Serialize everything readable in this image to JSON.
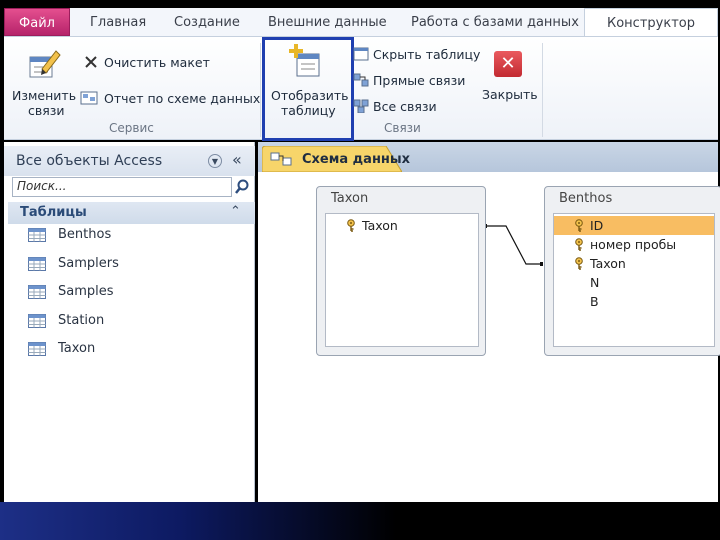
{
  "tabs": {
    "file": "Файл",
    "home": "Главная",
    "create": "Создание",
    "external": "Внешние данные",
    "dbtools": "Работа с базами данных",
    "design": "Конструктор"
  },
  "ribbon": {
    "edit_relations_1": "Изменить",
    "edit_relations_2": "связи",
    "clear_layout": "Очистить макет",
    "relationship_report": "Отчет по схеме данных",
    "group_tools": "Сервис",
    "show_table_1": "Отобразить",
    "show_table_2": "таблицу",
    "hide_table": "Скрыть таблицу",
    "direct_relationships": "Прямые связи",
    "all_relationships": "Все связи",
    "close": "Закрыть",
    "group_relationships": "Связи"
  },
  "nav": {
    "title": "Все объекты Access",
    "search_placeholder": "Поиск...",
    "section": "Таблицы",
    "items": [
      "Benthos",
      "Samplers",
      "Samples",
      "Station",
      "Taxon"
    ]
  },
  "document": {
    "tab_label": "Схема данных",
    "tables": [
      {
        "title": "Taxon",
        "fields": [
          {
            "name": "Taxon",
            "key": true
          }
        ]
      },
      {
        "title": "Benthos",
        "fields": [
          {
            "name": "ID",
            "key": true,
            "selected": true
          },
          {
            "name": "номер пробы",
            "key": true
          },
          {
            "name": "Taxon",
            "key": true
          },
          {
            "name": "N",
            "key": false
          },
          {
            "name": "B",
            "key": false
          }
        ]
      }
    ]
  },
  "colors": {
    "file_tab": "#c2307a",
    "highlight": "#1f3fb0",
    "selected_field": "#f8bd62",
    "close_red": "#d9363e"
  }
}
